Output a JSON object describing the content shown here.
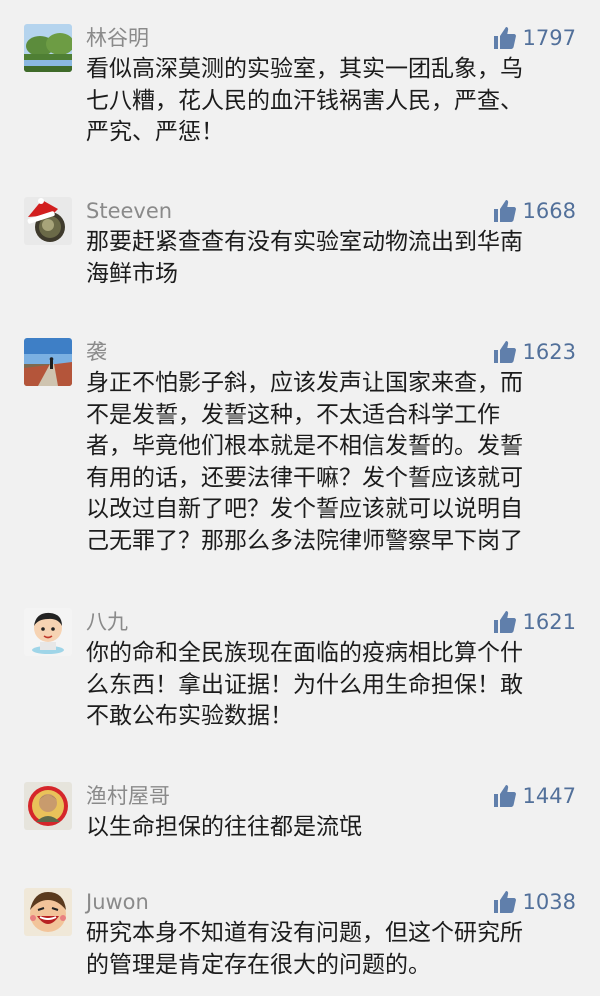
{
  "comments": [
    {
      "username": "林谷明",
      "likes": "1797",
      "lines": [
        "看似高深莫测的实验室，其实一团乱象，乌",
        "七八糟，花人民的血汗钱祸害人民，严查、",
        "严究、严惩！"
      ],
      "avatar_icon": "landscape-avatar-icon"
    },
    {
      "username": "Steeven",
      "likes": "1668",
      "lines": [
        "那要赶紧查查有没有实验室动物流出到华南",
        "海鲜市场"
      ],
      "avatar_icon": "santa-hat-avatar-icon"
    },
    {
      "username": "袭",
      "likes": "1623",
      "lines": [
        "身正不怕影子斜，应该发声让国家来查，而",
        "不是发誓，发誓这种，不太适合科学工作",
        "者，毕竟他们根本就是不相信发誓的。发誓",
        "有用的话，还要法律干嘛？发个誓应该就可",
        "以改过自新了吧？发个誓应该就可以说明自",
        "己无罪了？那那么多法院律师警察早下岗了"
      ],
      "avatar_icon": "road-photo-avatar-icon"
    },
    {
      "username": "八九",
      "likes": "1621",
      "lines": [
        "你的命和全民族现在面临的疫病相比算个什",
        "么东西！拿出证据！为什么用生命担保！敢",
        "不敢公布实验数据！"
      ],
      "avatar_icon": "cartoon-boy-avatar-icon"
    },
    {
      "username": "渔村屋哥",
      "likes": "1447",
      "lines": [
        "以生命担保的往往都是流氓"
      ],
      "avatar_icon": "portrait-avatar-icon"
    },
    {
      "username": "Juwon",
      "likes": "1038",
      "lines": [
        "研究本身不知道有没有问题，但这个研究所",
        "的管理是肯定存在很大的问题的。"
      ],
      "avatar_icon": "laughing-cartoon-avatar-icon"
    }
  ],
  "colors": {
    "background": "#f1f1f1",
    "username": "#8a8a8a",
    "like_count": "#52709a",
    "thumb_icon": "#607fab",
    "text": "#1c1c1c"
  }
}
